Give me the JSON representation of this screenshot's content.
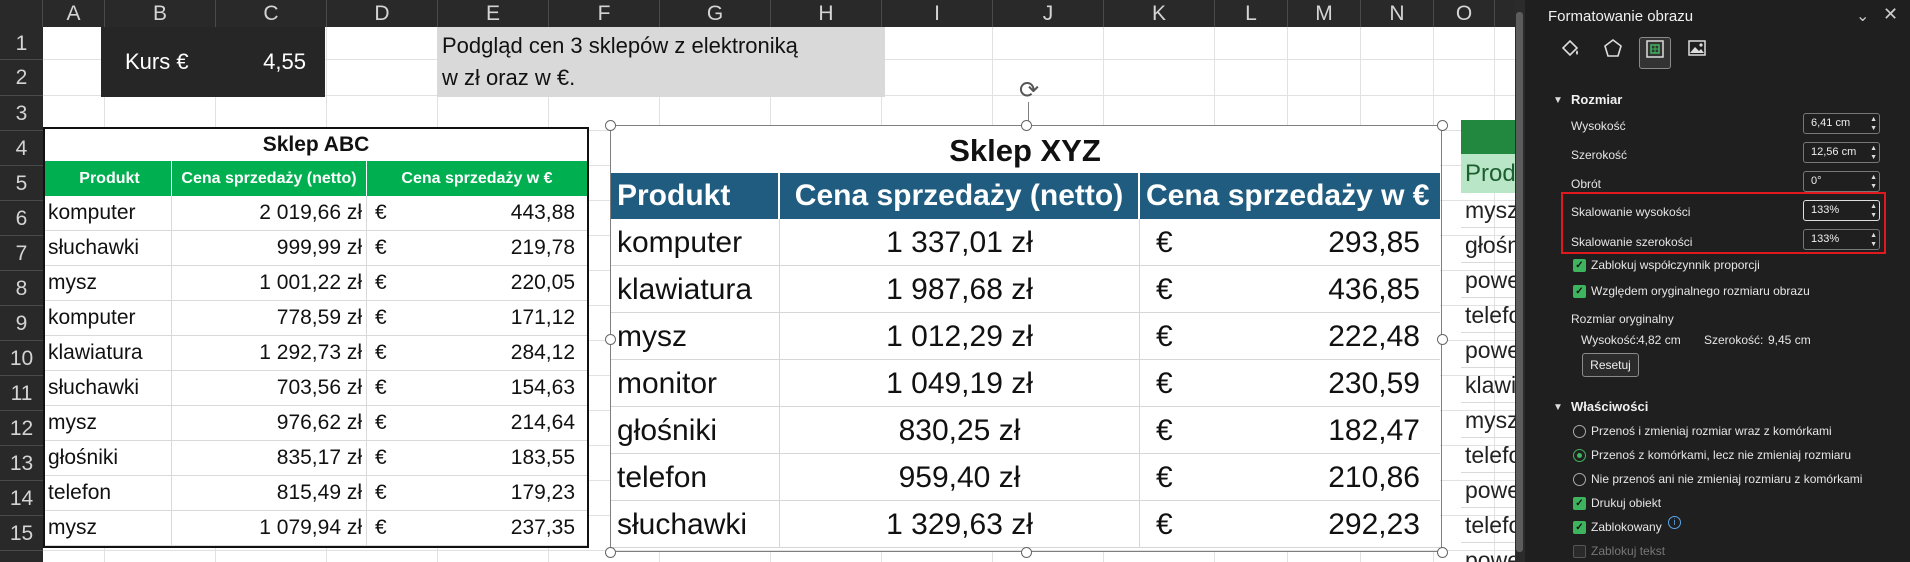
{
  "sheet": {
    "columns": [
      "A",
      "B",
      "C",
      "D",
      "E",
      "F",
      "G",
      "H",
      "I",
      "J",
      "K",
      "L",
      "M",
      "N",
      "O"
    ],
    "rows": [
      "1",
      "2",
      "3",
      "4",
      "5",
      "6",
      "7",
      "8",
      "9",
      "10",
      "11",
      "12",
      "13",
      "14",
      "15"
    ]
  },
  "kurs": {
    "label": "Kurs €",
    "value": "4,55"
  },
  "note": {
    "line1": "Podgląd cen 3 sklepów z elektroniką",
    "line2": "w zł oraz w €."
  },
  "abc": {
    "title": "Sklep ABC",
    "headers": [
      "Produkt",
      "Cena sprzedaży (netto)",
      "Cena sprzedaży w €"
    ],
    "rows": [
      {
        "product": "komputer",
        "pln": "2 019,66 zł",
        "cur": "€",
        "eur": "443,88"
      },
      {
        "product": "słuchawki",
        "pln": "999,99 zł",
        "cur": "€",
        "eur": "219,78"
      },
      {
        "product": "mysz",
        "pln": "1 001,22 zł",
        "cur": "€",
        "eur": "220,05"
      },
      {
        "product": "komputer",
        "pln": "778,59 zł",
        "cur": "€",
        "eur": "171,12"
      },
      {
        "product": "klawiatura",
        "pln": "1 292,73 zł",
        "cur": "€",
        "eur": "284,12"
      },
      {
        "product": "słuchawki",
        "pln": "703,56 zł",
        "cur": "€",
        "eur": "154,63"
      },
      {
        "product": "mysz",
        "pln": "976,62 zł",
        "cur": "€",
        "eur": "214,64"
      },
      {
        "product": "głośniki",
        "pln": "835,17 zł",
        "cur": "€",
        "eur": "183,55"
      },
      {
        "product": "telefon",
        "pln": "815,49 zł",
        "cur": "€",
        "eur": "179,23"
      },
      {
        "product": "mysz",
        "pln": "1 079,94 zł",
        "cur": "€",
        "eur": "237,35"
      }
    ]
  },
  "xyz": {
    "title": "Sklep XYZ",
    "headers": [
      "Produkt",
      "Cena sprzedaży (netto)",
      "Cena sprzedaży w €"
    ],
    "rows": [
      {
        "product": "komputer",
        "pln": "1 337,01 zł",
        "cur": "€",
        "eur": "293,85"
      },
      {
        "product": "klawiatura",
        "pln": "1 987,68 zł",
        "cur": "€",
        "eur": "436,85"
      },
      {
        "product": "mysz",
        "pln": "1 012,29 zł",
        "cur": "€",
        "eur": "222,48"
      },
      {
        "product": "monitor",
        "pln": "1 049,19 zł",
        "cur": "€",
        "eur": "230,59"
      },
      {
        "product": "głośniki",
        "pln": "830,25 zł",
        "cur": "€",
        "eur": "182,47"
      },
      {
        "product": "telefon",
        "pln": "959,40 zł",
        "cur": "€",
        "eur": "210,86"
      },
      {
        "product": "słuchawki",
        "pln": "1 329,63 zł",
        "cur": "€",
        "eur": "292,23"
      }
    ]
  },
  "third": {
    "header": "Produ",
    "rows": [
      "mysz",
      "głośn",
      "powe",
      "telefo",
      "powe",
      "klawi",
      "mysz",
      "telefo",
      "powe",
      "telefo",
      "powe"
    ]
  },
  "pane": {
    "title": "Formatowanie obrazu",
    "tabs": [
      "fill-line",
      "effects",
      "size-properties",
      "picture"
    ],
    "size_section": "Rozmiar",
    "height_label": "Wysokość",
    "height_value": "6,41 cm",
    "width_label": "Szerokość",
    "width_value": "12,56 cm",
    "rotation_label": "Obrót",
    "rotation_value": "0°",
    "scale_h_label": "Skalowanie wysokości",
    "scale_h_value": "133%",
    "scale_w_label": "Skalowanie szerokości",
    "scale_w_value": "133%",
    "lock_ratio": "Zablokuj współczynnik proporcji",
    "relative_original": "Względem oryginalnego rozmiaru obrazu",
    "original_size_label": "Rozmiar oryginalny",
    "original_height_label": "Wysokość:",
    "original_height": "4,82 cm",
    "original_width_label": "Szerokość:",
    "original_width": "9,45 cm",
    "reset_label": "Resetuj",
    "props_section": "Właściwości",
    "radio1": "Przenoś i zmieniaj rozmiar wraz z komórkami",
    "radio2": "Przenoś z komórkami, lecz nie zmieniaj rozmiaru",
    "radio3": "Nie przenoś ani nie zmieniaj rozmiaru z komórkami",
    "print_object": "Drukuj obiekt",
    "locked": "Zablokowany",
    "lock_text": "Zablokuj tekst"
  },
  "colors": {
    "abc_header": "#00b050",
    "xyz_header": "#1f5c80",
    "highlight": "#e0191e",
    "check": "#3fb45f"
  }
}
